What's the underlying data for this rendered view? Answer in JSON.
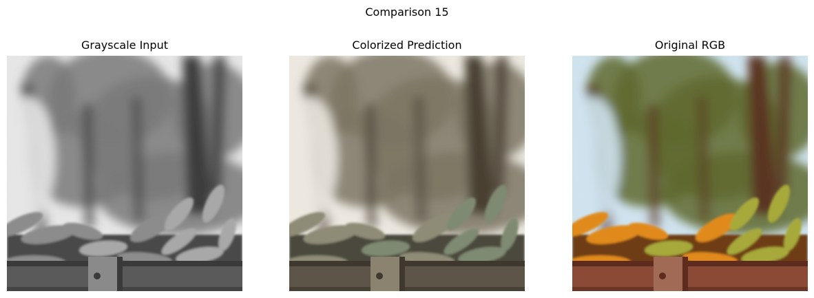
{
  "figure": {
    "suptitle": "Comparison 15"
  },
  "panels": [
    {
      "title": "Grayscale Input",
      "mode": "grayscale",
      "palette": {
        "sky": "#e6e6e6",
        "foliage": "#7a7a7a",
        "trunk": "#3c3c3c",
        "banana_a": "#8c8c8c",
        "banana_b": "#a8a8a8",
        "banana_shadow": "#4a4a4a",
        "crate": "#5a5a5a",
        "crate_dark": "#3a3a3a",
        "post": "#8a8a8a"
      }
    },
    {
      "title": "Colorized Prediction",
      "mode": "colorized",
      "palette": {
        "sky": "#ece8e0",
        "foliage": "#7d7564",
        "trunk": "#4a3f33",
        "banana_a": "#8e8b76",
        "banana_b": "#7f8a72",
        "banana_shadow": "#4c4a3e",
        "crate": "#5d5648",
        "crate_dark": "#3e382e",
        "post": "#8c8270"
      }
    },
    {
      "title": "Original RGB",
      "mode": "rgb",
      "palette": {
        "sky": "#cfe3ef",
        "foliage": "#5f6a2e",
        "trunk": "#5a3524",
        "banana_a": "#e08a1e",
        "banana_b": "#a7a93a",
        "banana_shadow": "#6e3e12",
        "crate": "#8a4a35",
        "crate_dark": "#5e2c1f",
        "post": "#a06a55"
      }
    }
  ]
}
